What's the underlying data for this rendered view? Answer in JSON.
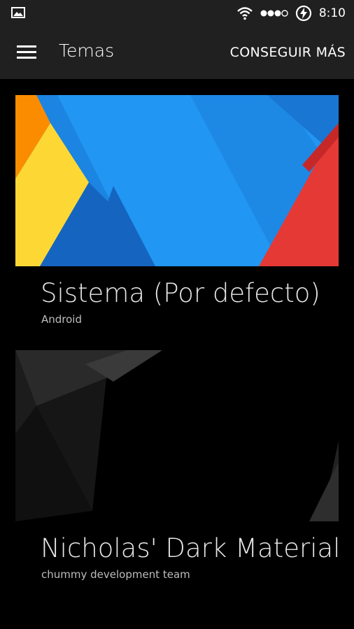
{
  "status_bar": {
    "time": "8:10",
    "icons": [
      "gallery-icon",
      "wifi-icon",
      "signal-icon",
      "battery-charging-icon"
    ]
  },
  "app_bar": {
    "title": "Temas",
    "get_more": "CONSEGUIR MÁS",
    "menu_icon": "menu-icon"
  },
  "themes": [
    {
      "name": "Sistema (Por defecto)",
      "author": "Android",
      "accent_colors": [
        "#2196F3",
        "#1565C0",
        "#FDD835",
        "#FB8C00",
        "#E53935"
      ]
    },
    {
      "name": "Nicholas' Dark Material",
      "author": "chummy development team",
      "accent_colors": [
        "#000000",
        "#2a2a2a",
        "#444444"
      ]
    }
  ]
}
